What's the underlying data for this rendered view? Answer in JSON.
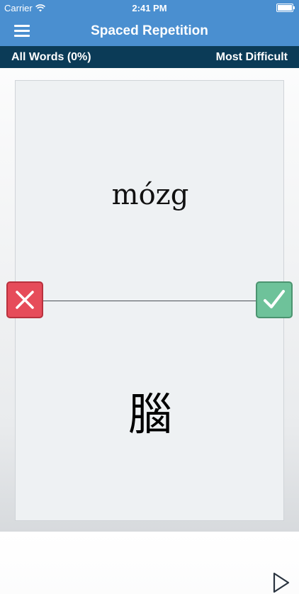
{
  "status_bar": {
    "carrier": "Carrier",
    "time": "2:41 PM",
    "icons": [
      "wifi-icon",
      "battery-icon"
    ]
  },
  "nav": {
    "title": "Spaced Repetition",
    "menu_icon": "menu-icon"
  },
  "filter_bar": {
    "left": "All Words (0%)",
    "right": "Most Difficult"
  },
  "card": {
    "word": "mózg",
    "translation": "腦"
  },
  "actions": {
    "wrong_icon": "close-icon",
    "right_icon": "check-icon",
    "play_icon": "play-icon"
  },
  "colors": {
    "nav": "#4a8fd0",
    "sub_bar": "#0b3b57",
    "wrong": "#e64c5a",
    "right": "#6ec29a"
  }
}
